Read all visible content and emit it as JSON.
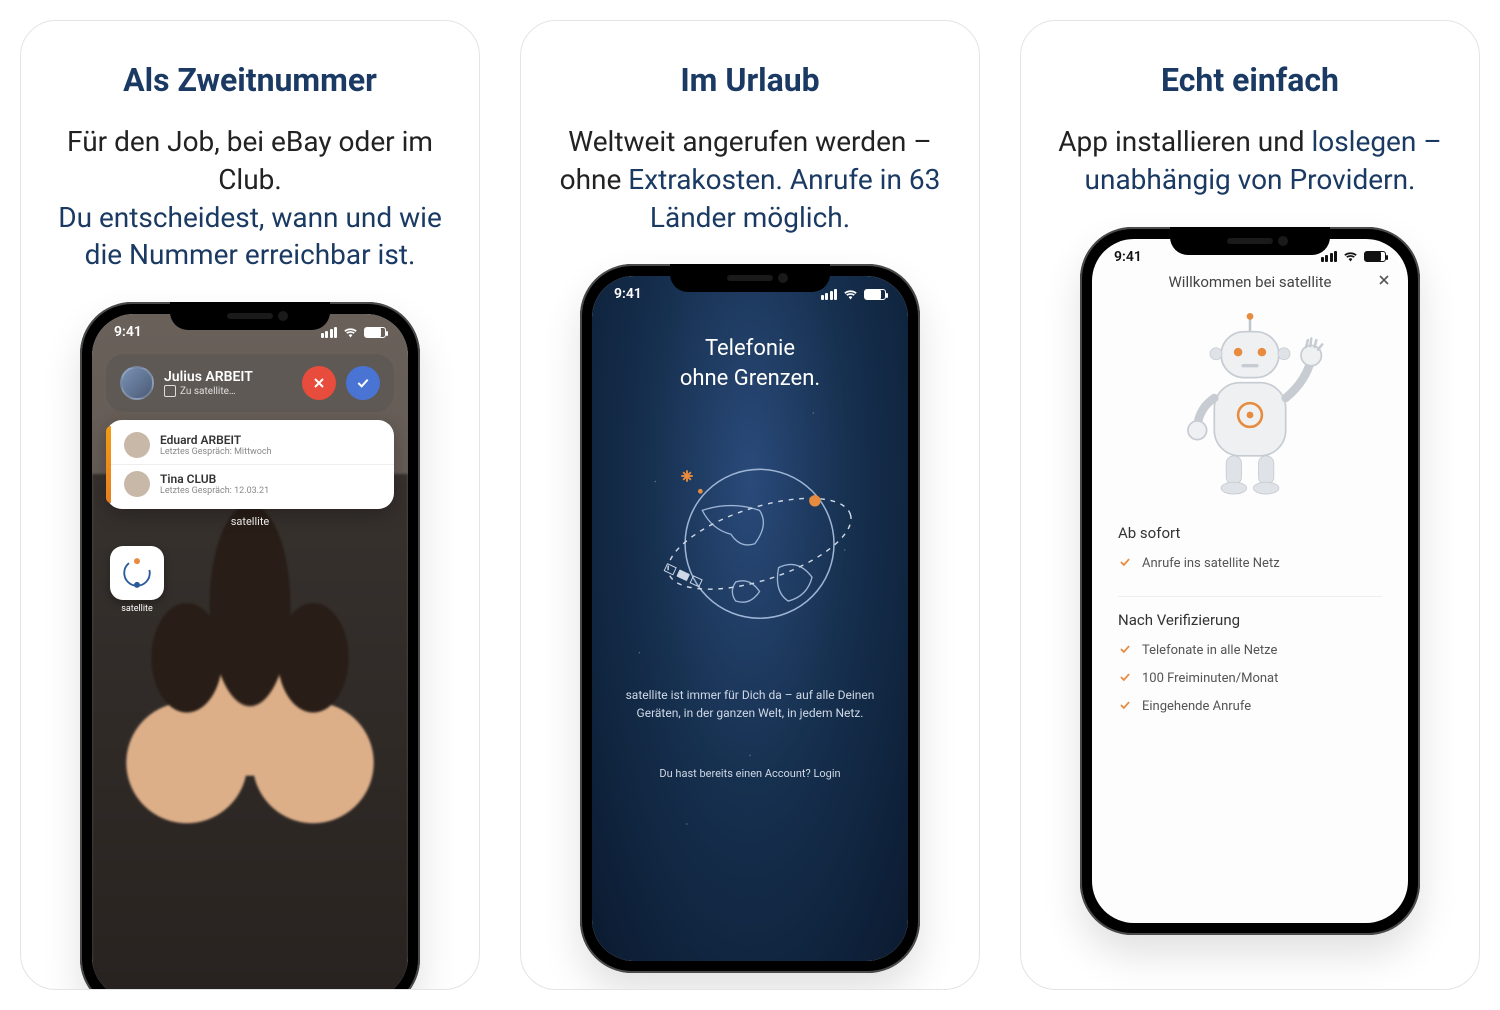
{
  "status_time": "9:41",
  "cards": [
    {
      "title": "Als Zweitnummer",
      "desc_plain": "Für den Job, bei eBay oder im Club.",
      "desc_blue": "Du entscheidest, wann und wie die Nummer erreichbar ist.",
      "call": {
        "name": "Julius ARBEIT",
        "sub": "Zu satellite…"
      },
      "recents": [
        {
          "name": "Eduard ARBEIT",
          "sub": "Letztes Gespräch: Mittwoch"
        },
        {
          "name": "Tina CLUB",
          "sub": "Letztes Gespräch: 12.03.21"
        }
      ],
      "widget_label": "satellite",
      "app_label": "satellite"
    },
    {
      "title": "Im Urlaub",
      "desc_plain": "Weltweit angerufen werden – ohne",
      "desc_blue": "Extrakosten. Anrufe in 63 Länder möglich.",
      "screen_title_l1": "Telefonie",
      "screen_title_l2": "ohne Grenzen.",
      "screen_desc": "satellite ist immer für Dich da – auf alle Deinen Geräten, in der ganzen Welt, in jedem Netz.",
      "login": "Du hast bereits einen Account? Login"
    },
    {
      "title": "Echt einfach",
      "desc_plain": "App installieren und",
      "desc_blue": "loslegen – unabhängig von Providern.",
      "header": "Willkommen bei satellite",
      "section1": "Ab sofort",
      "features1": [
        "Anrufe ins satellite Netz"
      ],
      "section2": "Nach Verifizierung",
      "features2": [
        "Telefonate in alle Netze",
        "100 Freiminuten/Monat",
        "Eingehende Anrufe"
      ]
    }
  ]
}
